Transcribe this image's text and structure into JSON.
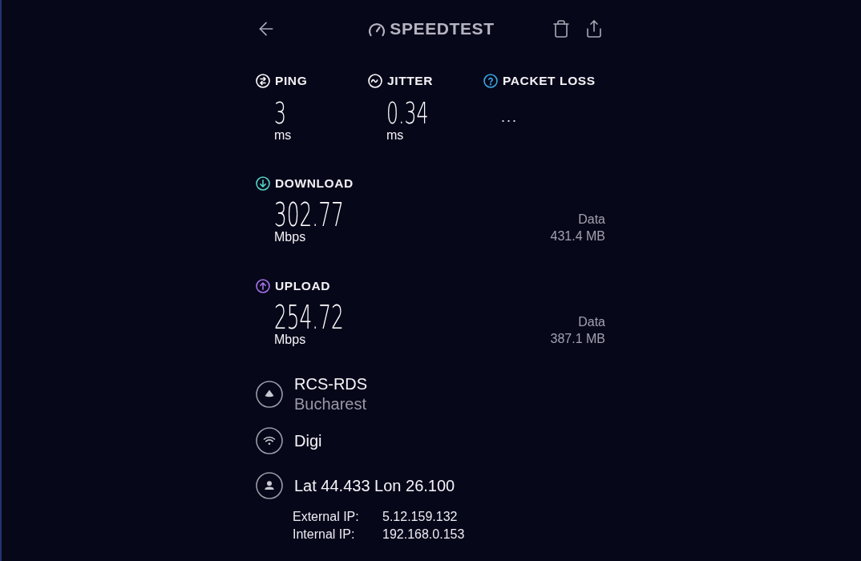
{
  "header": {
    "logo": "SPEEDTEST"
  },
  "latency": [
    {
      "kind": "ping",
      "label": "PING",
      "value": "3",
      "unit": "ms",
      "color": "#ffffff"
    },
    {
      "kind": "jitter",
      "label": "JITTER",
      "value": "0.34",
      "unit": "ms",
      "color": "#ffffff"
    },
    {
      "kind": "packet_loss",
      "label": "PACKET LOSS",
      "value": "...",
      "color": "#3aa6e0"
    }
  ],
  "transfers": [
    {
      "kind": "download",
      "label": "DOWNLOAD",
      "value": "302.77",
      "unit": "Mbps",
      "data_label": "Data",
      "data_value": "431.4 MB",
      "color": "#56d3c4"
    },
    {
      "kind": "upload",
      "label": "UPLOAD",
      "value": "254.72",
      "unit": "Mbps",
      "data_label": "Data",
      "data_value": "387.1 MB",
      "color": "#a372e6"
    }
  ],
  "details": [
    {
      "kind": "server",
      "title": "RCS-RDS",
      "subtitle": "Bucharest"
    },
    {
      "kind": "provider",
      "title": "Digi"
    },
    {
      "kind": "location",
      "title": "Lat 44.433 Lon 26.100"
    }
  ],
  "ips": [
    {
      "label": "External IP:",
      "value": "5.12.159.132"
    },
    {
      "label": "Internal IP:",
      "value": "192.168.0.153"
    }
  ]
}
